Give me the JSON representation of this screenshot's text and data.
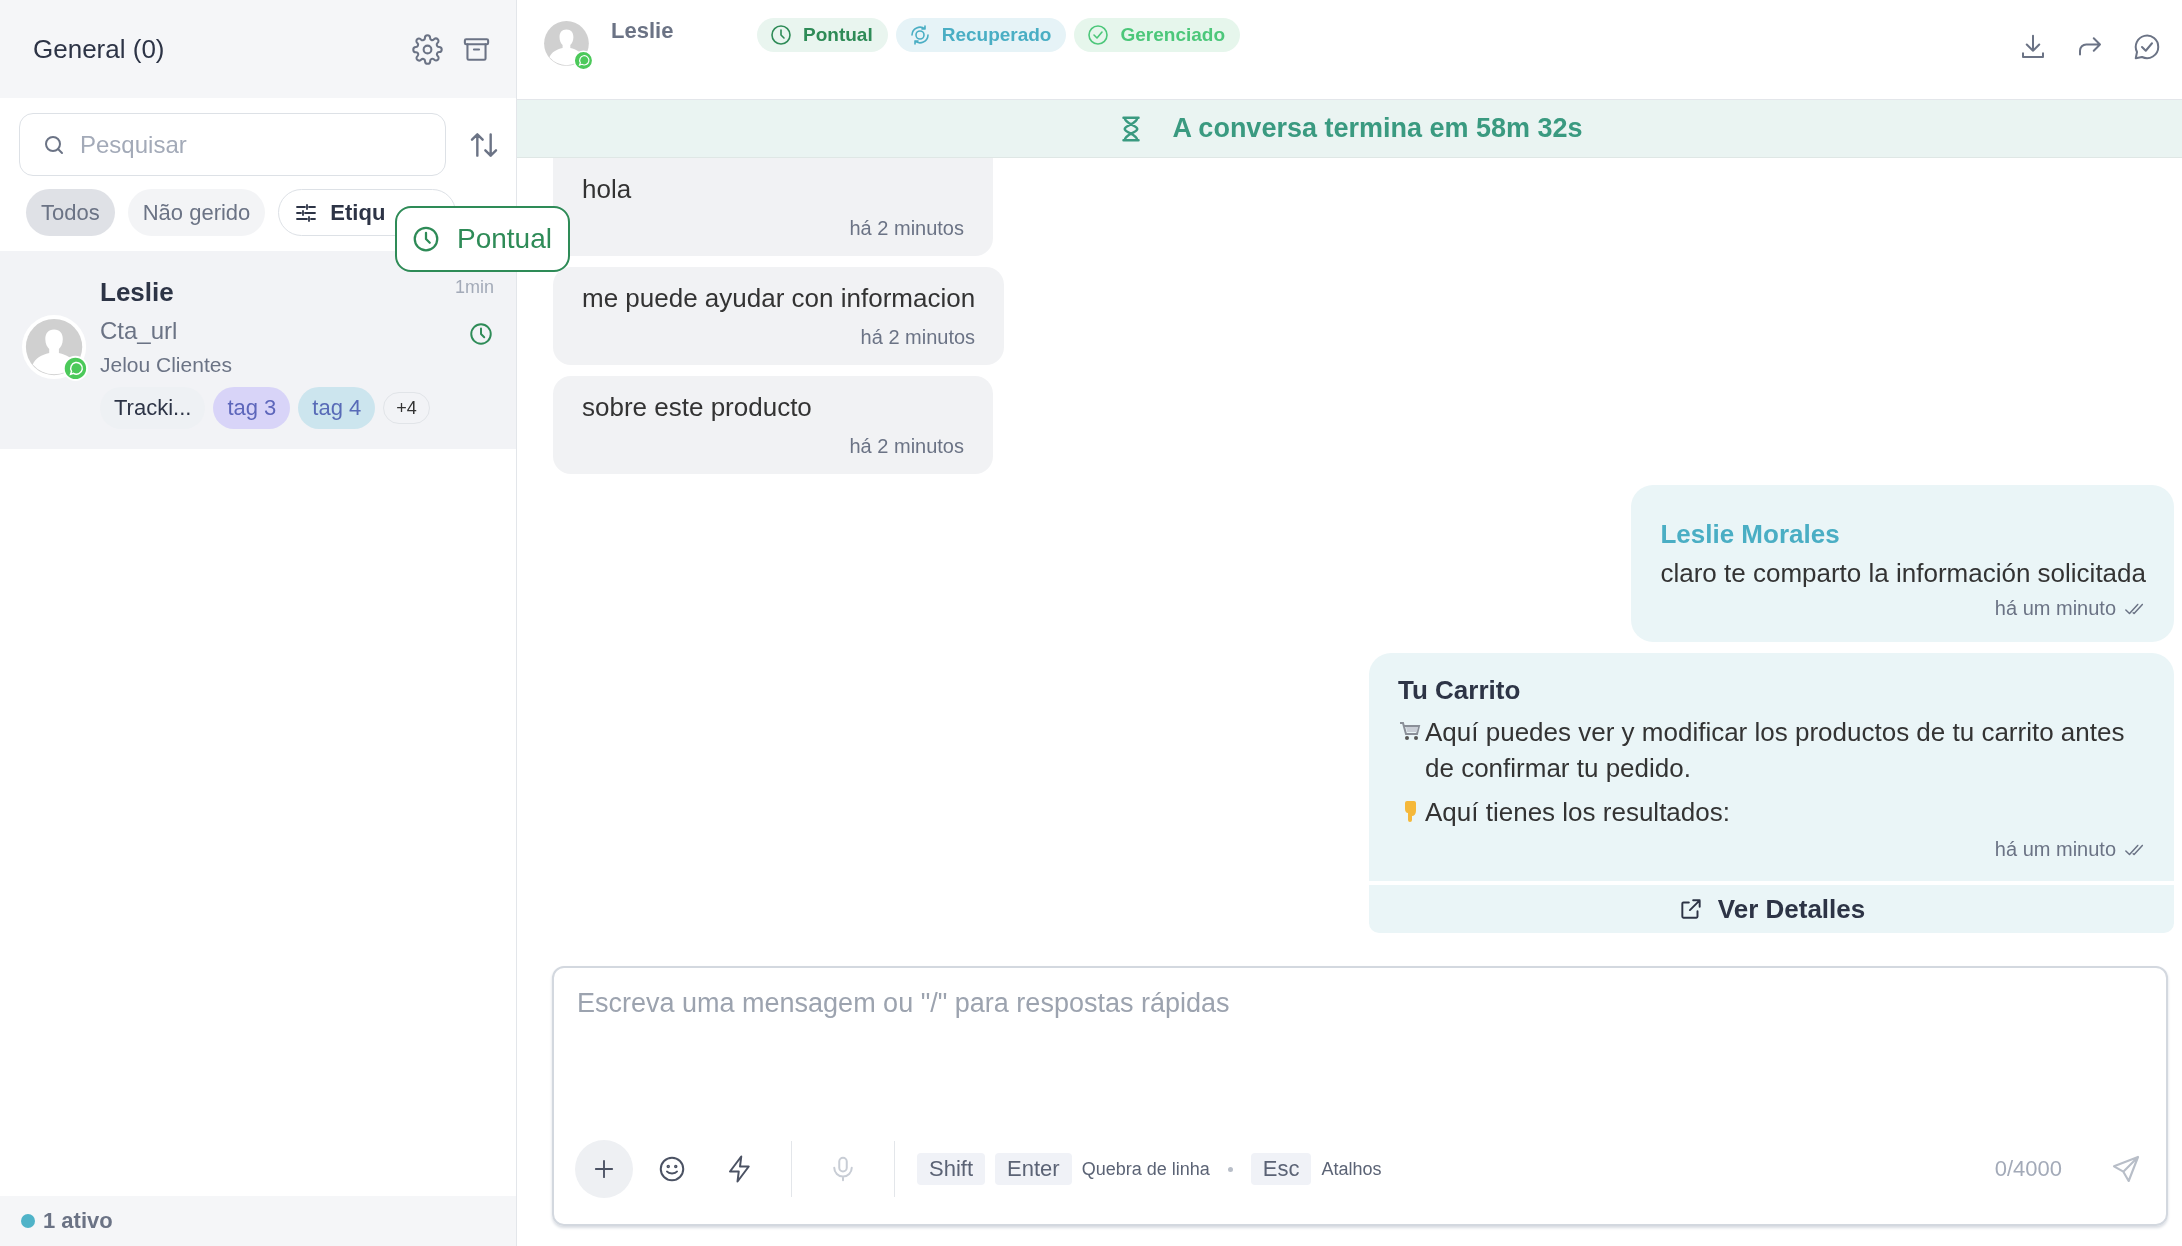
{
  "sidebar": {
    "title": "General (0)",
    "search": {
      "placeholder": "Pesquisar"
    },
    "filters": [
      {
        "label": "Todos",
        "kind": "chip",
        "selected": true
      },
      {
        "label": "Não gerido",
        "kind": "chip",
        "selected": false
      },
      {
        "label": "Etiqu",
        "kind": "dropdown",
        "selected": false
      }
    ],
    "tooltip": {
      "label": "Pontual"
    },
    "conversations": [
      {
        "name": "Leslie",
        "time": "1min",
        "subject": "Cta_url",
        "inbox": "Jelou Clientes",
        "selected": true,
        "more": "+4",
        "tags": [
          {
            "label": "Tracki...",
            "color": "#eef1f4"
          },
          {
            "label": "tag 3",
            "color": "#d8d4f8"
          },
          {
            "label": "tag 4",
            "color": "#cce5ee"
          }
        ]
      }
    ],
    "footer": {
      "status": "1 ativo"
    }
  },
  "chat": {
    "contact": "Leslie",
    "badges": [
      {
        "label": "Pontual",
        "kind": "clock"
      },
      {
        "label": "Recuperado",
        "kind": "recovered"
      },
      {
        "label": "Gerenciado",
        "kind": "check"
      }
    ],
    "banner": "A conversa termina em 58m 32s",
    "messages": [
      {
        "kind": "incoming",
        "text": "hola",
        "time": "há 2 minutos"
      },
      {
        "kind": "incoming",
        "text": "me puede ayudar con informacion",
        "time": "há 2 minutos"
      },
      {
        "kind": "incoming",
        "text": "sobre este producto",
        "time": "há 2 minutos"
      },
      {
        "kind": "outgoing",
        "sender": "Leslie Morales",
        "text": "claro te comparto la información solicitada",
        "time": "há um minuto",
        "read": true
      },
      {
        "kind": "card",
        "title": "Tu Carrito",
        "lines": [
          {
            "kind": "cart",
            "text": "Aquí puedes ver y modificar los productos de tu carrito antes de confirmar tu pedido."
          },
          {
            "kind": "pointing-down",
            "text": "Aquí tienes los resultados:"
          }
        ],
        "time": "há um minuto",
        "read": true,
        "button": "Ver Detalles"
      }
    ]
  },
  "composer": {
    "placeholder": "Escreva uma mensagem ou \"/\" para respostas rápidas",
    "tools": [
      {
        "kind": "plus",
        "disabled": false
      },
      {
        "kind": "emoji",
        "disabled": false
      },
      {
        "kind": "bolt",
        "disabled": false
      },
      {
        "kind": "mic",
        "disabled": true
      }
    ],
    "shortcuts": [
      {
        "keys": [
          "Shift",
          "Enter"
        ],
        "label": "Quebra de linha"
      },
      {
        "keys": [
          "Esc"
        ],
        "label": "Atalhos"
      }
    ],
    "counter": "0/4000"
  }
}
